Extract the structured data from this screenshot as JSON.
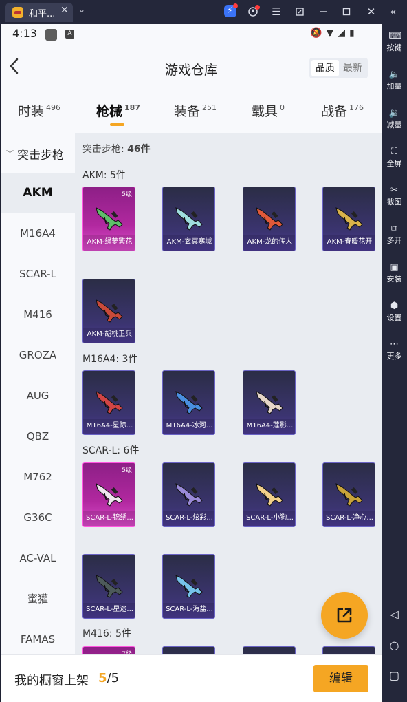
{
  "window": {
    "tab_title": "和平...",
    "tab_close": "✕",
    "dropdown": "⌄"
  },
  "right_toolbar": [
    {
      "label": "按键",
      "icon": "keyboard-icon"
    },
    {
      "label": "加量",
      "icon": "volume-up-icon"
    },
    {
      "label": "减量",
      "icon": "volume-down-icon"
    },
    {
      "label": "全屏",
      "icon": "fullscreen-icon"
    },
    {
      "label": "截图",
      "icon": "scissors-icon"
    },
    {
      "label": "多开",
      "icon": "multi-instance-icon"
    },
    {
      "label": "安装",
      "icon": "apk-icon"
    },
    {
      "label": "设置",
      "icon": "gear-icon"
    },
    {
      "label": "更多",
      "icon": "more-icon"
    }
  ],
  "status_bar": {
    "time": "4:13",
    "badge": "A"
  },
  "header": {
    "title": "游戏仓库",
    "sort_quality": "品质",
    "sort_latest": "最新"
  },
  "category_tabs": [
    {
      "label": "时装",
      "count": "496",
      "active": false
    },
    {
      "label": "枪械",
      "count": "187",
      "active": true
    },
    {
      "label": "装备",
      "count": "251",
      "active": false
    },
    {
      "label": "载具",
      "count": "0",
      "active": false
    },
    {
      "label": "战备",
      "count": "176",
      "active": false
    }
  ],
  "weapon_nav": {
    "group": "突击步枪",
    "items": [
      "AKM",
      "M16A4",
      "SCAR-L",
      "M416",
      "GROZA",
      "AUG",
      "QBZ",
      "M762",
      "G36C",
      "AC-VAL",
      "蜜獾",
      "FAMAS"
    ],
    "active": "AKM"
  },
  "content": {
    "summary_label": "突击步枪:",
    "summary_count": "46件",
    "groups": [
      {
        "title": "AKM: 5件",
        "items": [
          {
            "name": "AKM-绿萝繁花",
            "level": "5级",
            "rarity": "pink",
            "gun_color": "#5fbf6a"
          },
          {
            "name": "AKM-玄冥寒域",
            "level": "",
            "rarity": "purple",
            "gun_color": "#9fdede"
          },
          {
            "name": "AKM-龙的传人",
            "level": "",
            "rarity": "purple",
            "gun_color": "#e0593a"
          },
          {
            "name": "AKM-春暖花开",
            "level": "",
            "rarity": "purple",
            "gun_color": "#d9b24a"
          },
          {
            "name": "AKM-胡桃卫兵",
            "level": "",
            "rarity": "purple",
            "gun_color": "#c94a3a"
          }
        ]
      },
      {
        "title": "M16A4: 3件",
        "items": [
          {
            "name": "M16A4-星际...",
            "level": "",
            "rarity": "purple",
            "gun_color": "#d14545"
          },
          {
            "name": "M16A4-冰河...",
            "level": "",
            "rarity": "purple",
            "gun_color": "#4a8fe0"
          },
          {
            "name": "M16A4-莲影...",
            "level": "",
            "rarity": "purple",
            "gun_color": "#e6d6c8"
          }
        ]
      },
      {
        "title": "SCAR-L: 6件",
        "items": [
          {
            "name": "SCAR-L-锦绣...",
            "level": "5级",
            "rarity": "pink",
            "gun_color": "#f0e6ef"
          },
          {
            "name": "SCAR-L-炫彩...",
            "level": "",
            "rarity": "purple",
            "gun_color": "#9a8ad8"
          },
          {
            "name": "SCAR-L-小狗...",
            "level": "",
            "rarity": "purple",
            "gun_color": "#f2d08a"
          },
          {
            "name": "SCAR-L-净心...",
            "level": "",
            "rarity": "purple",
            "gun_color": "#c9a33a"
          },
          {
            "name": "SCAR-L-星途...",
            "level": "",
            "rarity": "purple",
            "gun_color": "#4d5a5a"
          },
          {
            "name": "SCAR-L-海盐...",
            "level": "",
            "rarity": "purple",
            "gun_color": "#76c3ea"
          }
        ]
      },
      {
        "title": "M416: 5件",
        "items": [
          {
            "name": "",
            "level": "7级",
            "rarity": "pink",
            "gun_color": "#d05aa0"
          },
          {
            "name": "",
            "level": "",
            "rarity": "purple",
            "gun_color": "#7a7fd0"
          },
          {
            "name": "",
            "level": "",
            "rarity": "purple",
            "gun_color": "#7a7fd0"
          },
          {
            "name": "",
            "level": "",
            "rarity": "purple",
            "gun_color": "#7a7fd0"
          }
        ]
      }
    ]
  },
  "bottom_bar": {
    "label": "我的橱窗上架",
    "count_current": "5",
    "count_total": "/5",
    "edit_label": "编辑"
  },
  "colors": {
    "accent": "#f5a623",
    "pink_card": "#b1289f",
    "purple_card": "#3b3470"
  }
}
